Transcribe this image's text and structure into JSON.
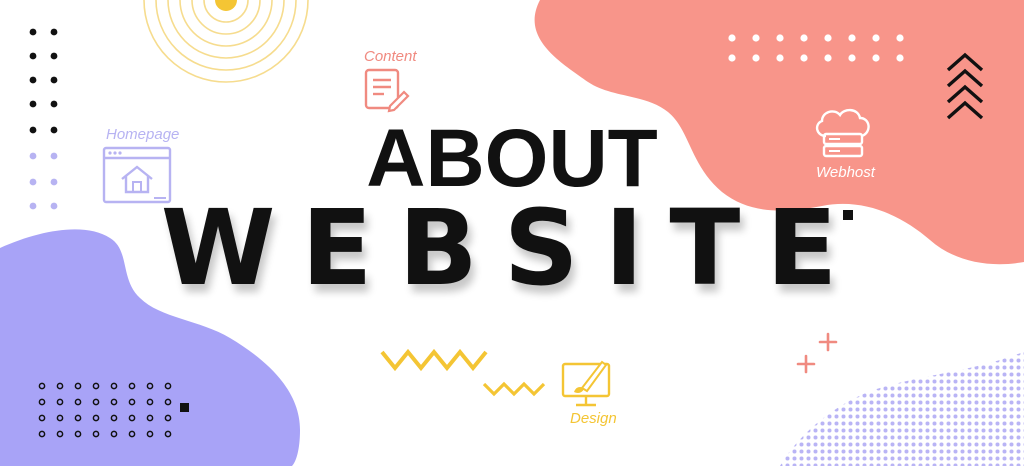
{
  "title": {
    "line1": "ABOUT",
    "line2": "WEBSITE"
  },
  "icons": {
    "content": {
      "label": "Content",
      "icon": "document-pen-icon"
    },
    "homepage": {
      "label": "Homepage",
      "icon": "browser-home-icon"
    },
    "webhost": {
      "label": "Webhost",
      "icon": "cloud-server-icon"
    },
    "design": {
      "label": "Design",
      "icon": "monitor-brush-icon"
    }
  },
  "colors": {
    "coral": "#f8958a",
    "lavender": "#a8a3f7",
    "yellow": "#f4c534",
    "content_icon": "#f08a80",
    "homepage_icon": "#b7b3f2",
    "text": "#111111"
  }
}
